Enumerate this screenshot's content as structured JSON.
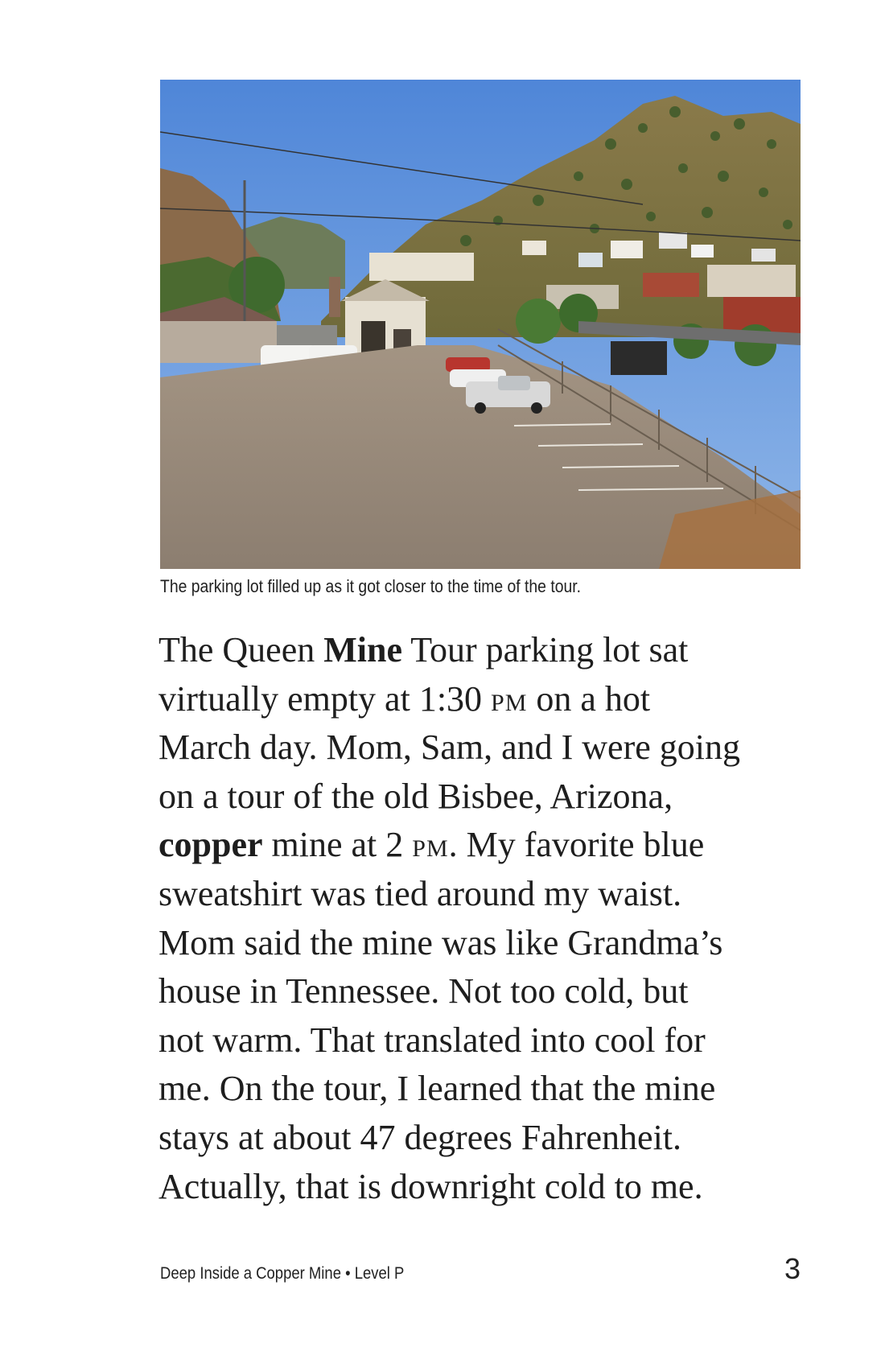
{
  "figure": {
    "caption": "The parking lot filled up as it got closer to the time of the tour."
  },
  "passage": {
    "line1": {
      "a": "The Queen ",
      "bold": "Mine",
      "b": " Tour parking lot sat"
    },
    "line2": {
      "a": "virtually empty at 1:30 ",
      "sc": "PM",
      "b": " on a hot"
    },
    "line3": "March day. Mom, Sam, and I were going",
    "line4": "on a tour of the old Bisbee, Arizona,",
    "line5": {
      "bold": "copper",
      "a": " mine at 2 ",
      "sc": "PM",
      "b": ". My favorite blue"
    },
    "line6": "sweatshirt was tied around my waist.",
    "line7": "Mom said the mine was like Grandma’s",
    "line8": "house in Tennessee. Not too cold, but",
    "line9": "not warm. That translated into cool for",
    "line10": "me. On the tour, I learned that the mine",
    "line11": "stays at about 47 degrees Fahrenheit.",
    "line12": "Actually, that is downright cold to me."
  },
  "footer": {
    "book_title": "Deep Inside a Copper Mine • Level P",
    "page_number": "3"
  }
}
